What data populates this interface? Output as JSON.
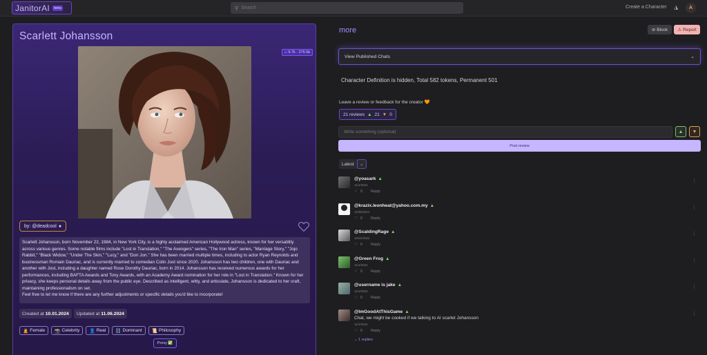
{
  "header": {
    "logo": "JanitorAI",
    "logo_badge": "beta",
    "search_placeholder": "Search",
    "create_character": "Create a Character",
    "avatar_letter": "A"
  },
  "character": {
    "name": "Scarlett Johansson",
    "stats": "9.7k · 276.5k",
    "creator": "by: @deadcool",
    "description": "Scarlett Johansson, born November 22, 1984, in New York City, is a highly acclaimed American Hollywood actress, known for her versatility across various genres. Some notable films include \"Lost in Translation,\" \"The Avengers\" series, \"The Iron Man\" series, \"Marriage Story,\" \"Jojo Rabbit,\" \"Black Widow,\" \"Under The Skin,\" \"Lucy,\" and \"Don Jon.\" She has been married multiple times, including to actor Ryan Reynolds and businessman Romain Dauriac, and is currently married to comedian Colin Jost since 2020. Johansson has two children, one with Dauriac and another with Jost, including a daughter named Rose Dorothy Dauriac, born in 2014. Johansson has received numerous awards for her performances, including BAFTA Awards and Tony Awards, with an Academy Award nomination for her role in \"Lost in Translation.\" Known for her privacy, she keeps personal details away from the public eye. Described as intelligent, witty, and articulate, Johansson is dedicated to her craft, maintaining professionalism on set.",
    "description_note": "Feel free to let me know if there are any further adjustments or specific details you'd like to incorporate!",
    "created_label": "Created at",
    "created_date": "10.01.2024",
    "updated_label": "Updated at",
    "updated_date": "11.06.2024",
    "tags": [
      {
        "icon": "🙎",
        "label": "Female"
      },
      {
        "icon": "📸",
        "label": "Celebrity"
      },
      {
        "icon": "👤",
        "label": "Real"
      },
      {
        "icon": "⛓️",
        "label": "Dominant"
      },
      {
        "icon": "📜",
        "label": "Philosophy"
      }
    ],
    "proxy": "Proxy ✅"
  },
  "right": {
    "title": "more",
    "block": "Block",
    "report": "Report",
    "published_chats": "View Published Chats",
    "definition_hidden": "Character Definition is hidden, Total 582 tokens, Permanent 501",
    "leave_review": "Leave a review or feedback for the creator 🧡",
    "reviews_count": "21 reviews",
    "up_count": "21",
    "down_count": "0",
    "write_placeholder": "Write something (optional)",
    "post_review": "Post review",
    "sort": "Latest"
  },
  "reviews": [
    {
      "name": "@yoasark",
      "date": "11/1/2024",
      "likes": "0",
      "reply": "Reply",
      "message": ""
    },
    {
      "name": "@krazix.leonheat@yahoo.com.my",
      "date": "11/06/2024",
      "likes": "0",
      "reply": "Reply",
      "message": ""
    },
    {
      "name": "@ScaldingRage",
      "date": "10/31/2024",
      "likes": "0",
      "reply": "Reply",
      "message": ""
    },
    {
      "name": "@Green Frog",
      "date": "11/1/2024",
      "likes": "0",
      "reply": "Reply",
      "message": ""
    },
    {
      "name": "@username is jake",
      "date": "11/1/2024",
      "likes": "0",
      "reply": "Reply",
      "message": ""
    },
    {
      "name": "@ImGoodAtThisGame",
      "date": "11/1/2024",
      "likes": "0",
      "reply": "Reply",
      "message": "Chat, we might be cooked if we talking to AI scarlet Johansson",
      "replies": "1 replies"
    }
  ]
}
